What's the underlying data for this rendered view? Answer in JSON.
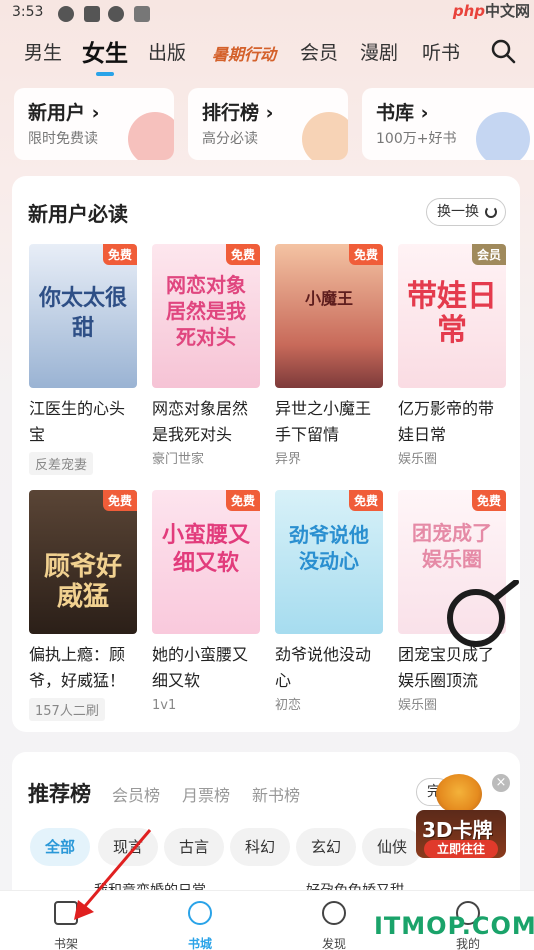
{
  "status": {
    "time": "3:53",
    "watermark_php": "php",
    "watermark_cn": "中文网"
  },
  "nav": {
    "tabs": [
      "男生",
      "女生",
      "出版",
      "暑期行动",
      "会员",
      "漫剧",
      "听书"
    ],
    "active": "女生"
  },
  "categories": [
    {
      "title": "新用户 ›",
      "sub": "限时免费读",
      "color": "#f7c5c2"
    },
    {
      "title": "排行榜 ›",
      "sub": "高分必读",
      "color": "#f7d8bd"
    },
    {
      "title": "书库 ›",
      "sub": "100万+好书",
      "color": "#c9d9f4"
    }
  ],
  "section": {
    "title": "新用户必读",
    "swap_label": "换一换"
  },
  "books": [
    {
      "title": "江医生的心头宝",
      "sub": "反差宠妻",
      "badge": "免费",
      "cover_text": "你太太很甜",
      "bg": "#c9d6ea",
      "fg": "#2e4f86"
    },
    {
      "title": "网恋对象居然是我死对头",
      "sub": "豪门世家",
      "badge": "免费",
      "cover_text": "网恋对象居然是我死对头",
      "bg": "#f8d3df",
      "fg": "#e0467f"
    },
    {
      "title": "异世之小魔王手下留情",
      "sub": "异界",
      "badge": "免费",
      "cover_text": "小魔王",
      "bg": "#e9a58c",
      "fg": "#7a2b22"
    },
    {
      "title": "亿万影帝的带娃日常",
      "sub": "娱乐圈",
      "badge": "会员",
      "cover_text": "带娃日常",
      "bg": "#fbe6ea",
      "fg": "#e43b4d"
    },
    {
      "title": "偏执上瘾：顾爷，好威猛！",
      "sub": "157人二刷",
      "badge": "免费",
      "cover_text": "顾爷好威猛",
      "bg": "#3b2b22",
      "fg": "#f1d190"
    },
    {
      "title": "她的小蛮腰又细又软",
      "sub": "1v1",
      "badge": "免费",
      "cover_text": "小蛮腰又细又软",
      "bg": "#fbd9e6",
      "fg": "#e23c7c"
    },
    {
      "title": "劲爷说他没动心",
      "sub": "初恋",
      "badge": "免费",
      "cover_text": "劲爷说他没动心",
      "bg": "#bfe6f3",
      "fg": "#2a8fd0"
    },
    {
      "title": "团宠宝贝成了娱乐圈顶流",
      "sub": "娱乐圈",
      "badge": "免费",
      "cover_text": "团宠成了娱乐圈",
      "bg": "#fbeaf0",
      "fg": "#e58aa6"
    }
  ],
  "rank": {
    "title": "推荐榜",
    "tabs": [
      "会员榜",
      "月票榜",
      "新书榜"
    ],
    "done_label": "完",
    "chips": [
      "全部",
      "现言",
      "古言",
      "科幻",
      "玄幻",
      "仙侠"
    ],
    "active_chip": "全部"
  },
  "promo": {
    "title": "3D卡牌",
    "action": "立即往往"
  },
  "peek": {
    "left": "我和竟变婚的日常",
    "right": "好孕兔兔娇又甜"
  },
  "bottom_nav": [
    {
      "label": "书架",
      "icon": "bookshelf-icon"
    },
    {
      "label": "书城",
      "icon": "smile-icon"
    },
    {
      "label": "发现",
      "icon": "compass-icon"
    },
    {
      "label": "我的",
      "icon": "profile-icon"
    }
  ],
  "bottom_active": "书城",
  "footer_watermark": "ITMOP.COM"
}
